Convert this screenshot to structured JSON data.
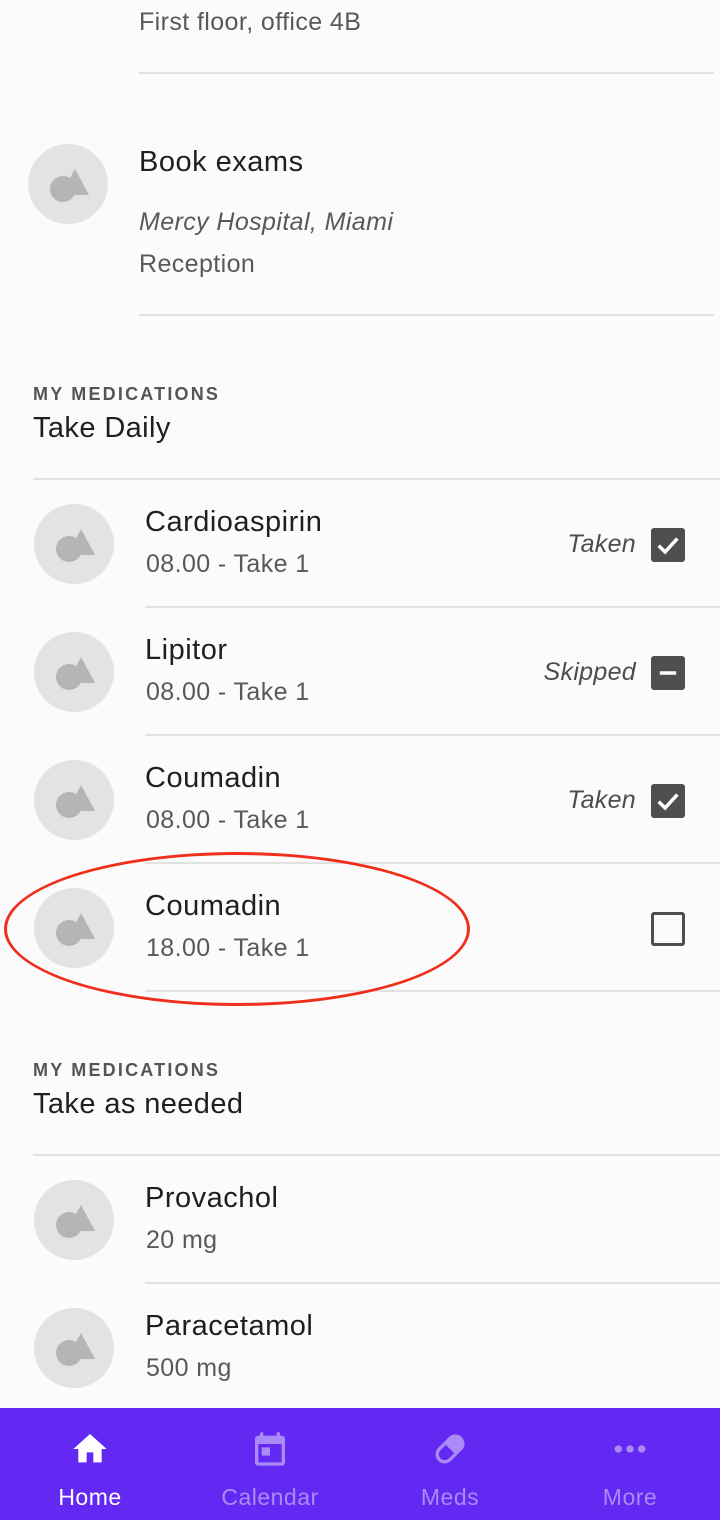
{
  "top_item": {
    "detail": "First floor, office 4B"
  },
  "book_exams": {
    "title": "Book exams",
    "location": "Mercy Hospital, Miami",
    "department": "Reception",
    "icon": "shapes-placeholder-icon"
  },
  "daily_section": {
    "overline": "MY MEDICATIONS",
    "title": "Take Daily",
    "items": [
      {
        "name": "Cardioaspirin",
        "schedule": "08.00 - Take 1",
        "status": "Taken",
        "state": "checked"
      },
      {
        "name": "Lipitor",
        "schedule": "08.00 - Take 1",
        "status": "Skipped",
        "state": "indeterminate"
      },
      {
        "name": "Coumadin",
        "schedule": "08.00 - Take 1",
        "status": "Taken",
        "state": "checked"
      },
      {
        "name": "Coumadin",
        "schedule": "18.00 - Take 1",
        "status": "",
        "state": "unchecked"
      }
    ]
  },
  "needed_section": {
    "overline": "MY MEDICATIONS",
    "title": "Take as needed",
    "items": [
      {
        "name": "Provachol",
        "dose": "20 mg"
      },
      {
        "name": "Paracetamol",
        "dose": "500 mg"
      }
    ]
  },
  "bottom_nav": {
    "items": [
      {
        "label": "Home",
        "icon": "home-icon",
        "active": true
      },
      {
        "label": "Calendar",
        "icon": "calendar-icon",
        "active": false
      },
      {
        "label": "Meds",
        "icon": "pill-icon",
        "active": false
      },
      {
        "label": "More",
        "icon": "more-horizontal-icon",
        "active": false
      }
    ]
  },
  "colors": {
    "nav_background": "#6329f2",
    "nav_active": "#ffffff",
    "nav_inactive": "#a98af7",
    "callout": "#ef2e1c",
    "checkbox": "#4f4f4f"
  }
}
